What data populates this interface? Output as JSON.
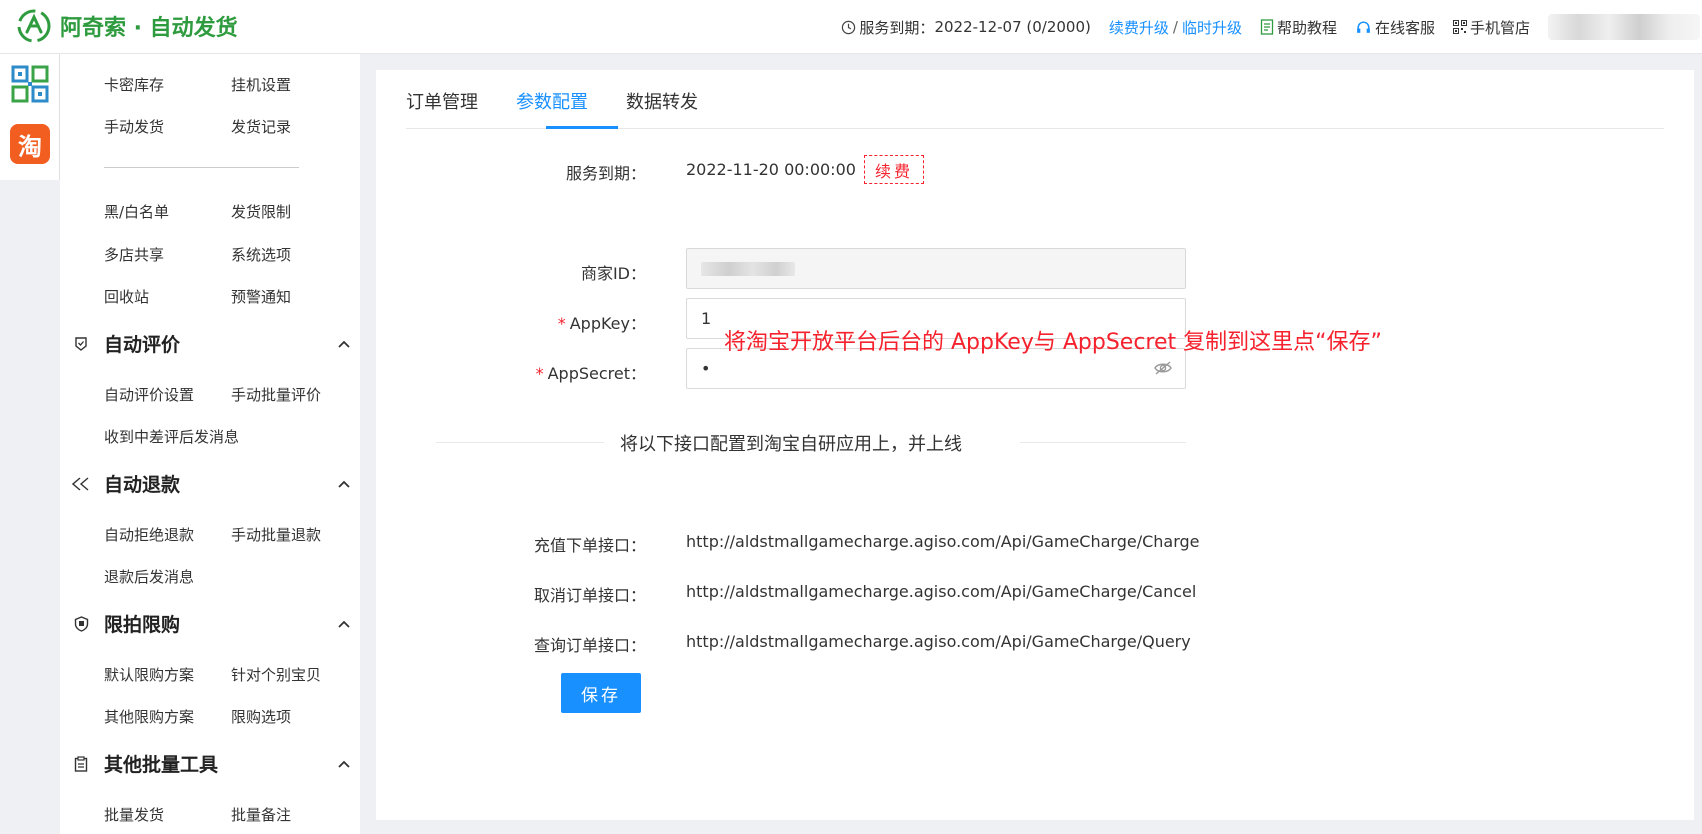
{
  "header": {
    "brand": "阿奇索 · 自动发货",
    "service_label": "服务到期：",
    "service_value": "2022-12-07 (0/2000)",
    "renew_upgrade": "续费升级",
    "separator": "/",
    "temp_upgrade": "临时升级",
    "help": "帮助教程",
    "online_service": "在线客服",
    "mobile_store": "手机管店"
  },
  "rail": {
    "taobao_label": "淘"
  },
  "menu": {
    "top": [
      [
        "卡密库存",
        "挂机设置"
      ],
      [
        "手动发货",
        "发货记录"
      ]
    ],
    "middle": [
      [
        "黑/白名单",
        "发货限制"
      ],
      [
        "多店共享",
        "系统选项"
      ],
      [
        "回收站",
        "预警通知"
      ]
    ],
    "groups": [
      {
        "title": "自动评价",
        "rows": [
          [
            "自动评价设置",
            "手动批量评价"
          ],
          [
            "收到中差评后发消息",
            ""
          ]
        ]
      },
      {
        "title": "自动退款",
        "rows": [
          [
            "自动拒绝退款",
            "手动批量退款"
          ],
          [
            "退款后发消息",
            ""
          ]
        ]
      },
      {
        "title": "限拍限购",
        "rows": [
          [
            "默认限购方案",
            "针对个别宝贝"
          ],
          [
            "其他限购方案",
            "限购选项"
          ]
        ]
      },
      {
        "title": "其他批量工具",
        "rows": [
          [
            "批量发货",
            "批量备注"
          ]
        ]
      }
    ]
  },
  "tabs": [
    "订单管理",
    "参数配置",
    "数据转发"
  ],
  "form": {
    "service_label": "服务到期：",
    "service_value": "2022-11-20 00:00:00",
    "renew_button": "续费",
    "merchant_label": "商家ID：",
    "appkey_label": "AppKey：",
    "appkey_value": "1",
    "appsecret_label": "AppSecret：",
    "appsecret_value": "•",
    "annotation": "将淘宝开放平台后台的 AppKey与 AppSecret 复制到这里点“保存”",
    "section_title": "将以下接口配置到淘宝自研应用上，并上线",
    "endpoints": [
      {
        "label": "充值下单接口：",
        "url": "http://aldstmallgamecharge.agiso.com/Api/GameCharge/Charge"
      },
      {
        "label": "取消订单接口：",
        "url": "http://aldstmallgamecharge.agiso.com/Api/GameCharge/Cancel"
      },
      {
        "label": "查询订单接口：",
        "url": "http://aldstmallgamecharge.agiso.com/Api/GameCharge/Query"
      }
    ],
    "save_button": "保存"
  },
  "colors": {
    "brand_green": "#2f9b3f",
    "accent_blue": "#1890ff",
    "danger_red": "#f5222d",
    "taobao_orange": "#f25d20"
  }
}
